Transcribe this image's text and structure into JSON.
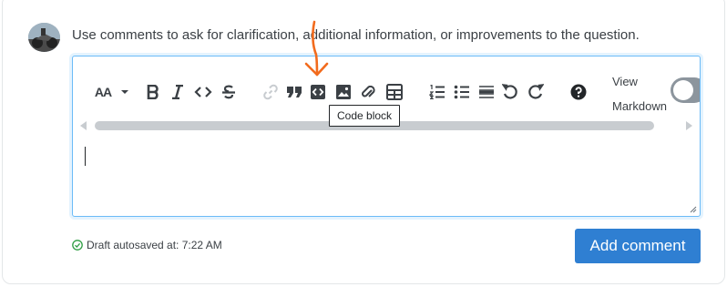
{
  "prompt_text": "Use comments to ask for clarification, additional information, or improvements to the question.",
  "toolbar": {
    "text_size_label": "AA",
    "view_markdown_line1": "View",
    "view_markdown_line2": "Markdown",
    "toggle_state": "off"
  },
  "tooltip": {
    "text": "Code block"
  },
  "draft": {
    "text": "Draft autosaved at: 7:22 AM"
  },
  "buttons": {
    "add_comment": "Add comment"
  },
  "colors": {
    "accent": "#2f7fd2",
    "focus_border": "#6bbbf7",
    "annotation_arrow": "#f26b1d",
    "success": "#2f9e44"
  }
}
